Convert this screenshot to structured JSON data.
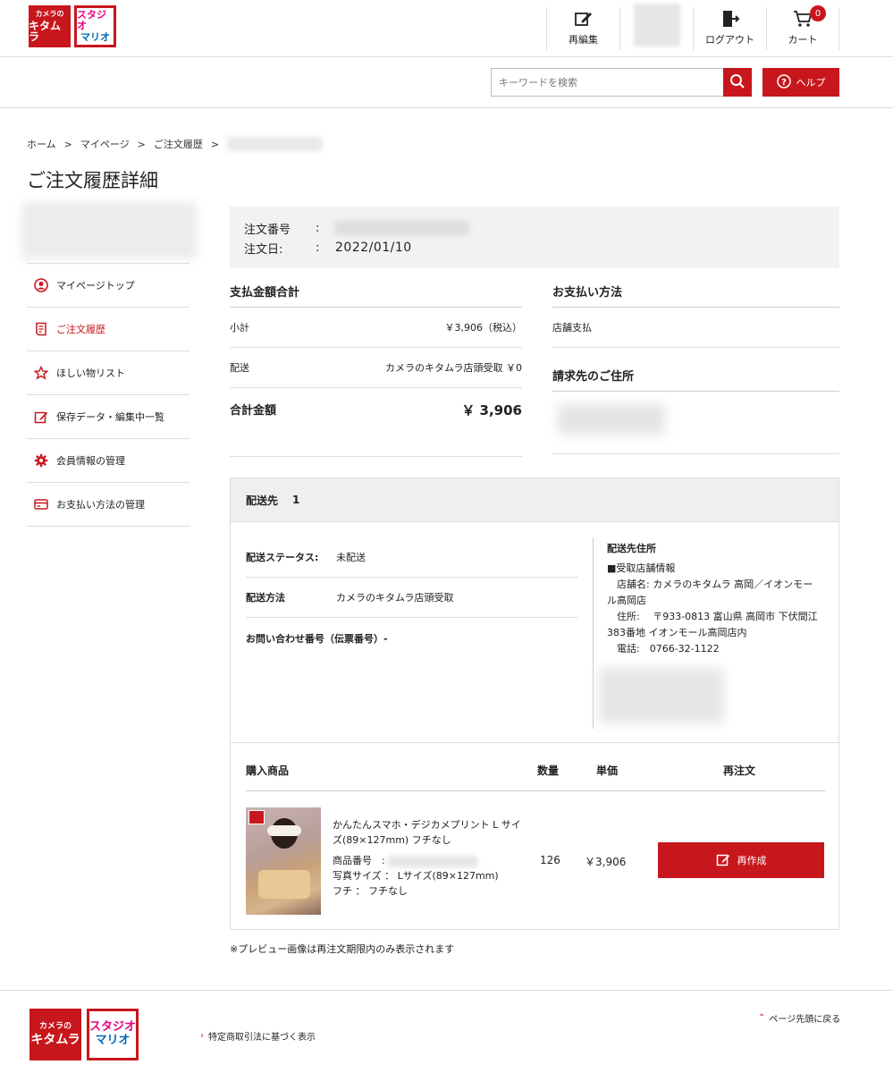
{
  "brand": {
    "kitamura_small": "カメラの",
    "kitamura_big": "キタムラ",
    "mario_line1": "スタジオ",
    "mario_line2": "マリオ"
  },
  "header_nav": {
    "reedit": "再編集",
    "logout": "ログアウト",
    "cart": "カート",
    "cart_count": "0"
  },
  "search": {
    "placeholder": "キーワードを検索",
    "help_label": "ヘルプ"
  },
  "breadcrumb": [
    "ホーム",
    ">",
    "マイページ",
    ">",
    "ご注文履歴",
    ">"
  ],
  "page_title": "ご注文履歴詳細",
  "sidebar": {
    "items": [
      {
        "label": "マイページトップ",
        "icon": "user-icon"
      },
      {
        "label": "ご注文履歴",
        "icon": "order-history-icon",
        "active": true
      },
      {
        "label": "ほしい物リスト",
        "icon": "star-icon"
      },
      {
        "label": "保存データ・編集中一覧",
        "icon": "edit-icon"
      },
      {
        "label": "会員情報の管理",
        "icon": "gear-icon"
      },
      {
        "label": "お支払い方法の管理",
        "icon": "credit-card-icon"
      }
    ]
  },
  "order": {
    "number_label": "注文番号",
    "date_label": "注文日:",
    "colon": ":",
    "date_value": "2022/01/10"
  },
  "payment": {
    "title": "支払金額合計",
    "subtotal_label": "小計",
    "subtotal_value": "￥3,906（税込）",
    "shipping_label": "配送",
    "shipping_value": "カメラのキタムラ店頭受取 ￥0",
    "total_label": "合計金額",
    "total_value": "￥ 3,906"
  },
  "payment_method": {
    "title": "お支払い方法",
    "value": "店舗支払",
    "billing_title": "請求先のご住所"
  },
  "delivery": {
    "head_label": "配送先",
    "head_number": "1",
    "status_label": "配送ステータス:",
    "status_value": "未配送",
    "method_label": "配送方法",
    "method_value": "カメラのキタムラ店頭受取",
    "tracking_label": "お問い合わせ番号（伝票番号）-",
    "address_title": "配送先住所",
    "address_lines": [
      "■受取店舗情報",
      "　店舗名:  カメラのキタムラ 高岡／イオンモー",
      "ル高岡店",
      "　住所:　 〒933-0813 富山県 高岡市 下伏間江",
      "383番地 イオンモール高岡店内",
      "　電話:　0766-32-1122"
    ]
  },
  "products": {
    "col_product": "購入商品",
    "col_qty": "数量",
    "col_price": "単価",
    "col_reorder": "再注文",
    "items": [
      {
        "name": "かんたんスマホ・デジカメプリント L サイズ(89×127mm) フチなし",
        "code_label": "商品番号　:",
        "size_line": "写真サイズ ： Lサイズ(89×127mm)",
        "border_line": "フチ ： フチなし",
        "qty": "126",
        "price": "￥3,906",
        "reorder_label": "再作成"
      }
    ]
  },
  "note": "※プレビュー画像は再注文期限内のみ表示されます",
  "footer": {
    "legal_link": "特定商取引法に基づく表示",
    "back_to_top": "ページ先頭に戻る"
  },
  "colors": {
    "accent": "#c8161d"
  }
}
